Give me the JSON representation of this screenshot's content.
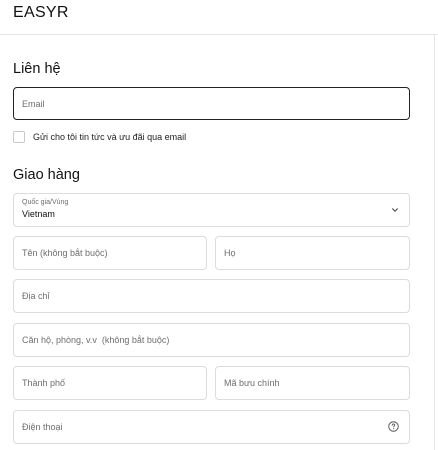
{
  "header": {
    "brand": "EASYR"
  },
  "contact": {
    "title": "Liên hệ",
    "email_placeholder": "Email",
    "newsletter_label": "Gửi cho tôi tin tức và ưu đãi qua email"
  },
  "shipping": {
    "title": "Giao hàng",
    "country_label": "Quốc gia/Vùng",
    "country_value": "Vietnam",
    "first_name_placeholder": "Tên (không bắt buộc)",
    "last_name_placeholder": "Họ",
    "address_placeholder": "Địa chỉ",
    "apartment_placeholder": "Căn hộ, phòng, v.v  (không bắt buộc)",
    "city_placeholder": "Thành phố",
    "postal_placeholder": "Mã bưu chính",
    "phone_placeholder": "Điện thoại"
  },
  "icons": {
    "country_dropdown": "chevron-down-icon",
    "phone_help": "help-circle-icon"
  }
}
